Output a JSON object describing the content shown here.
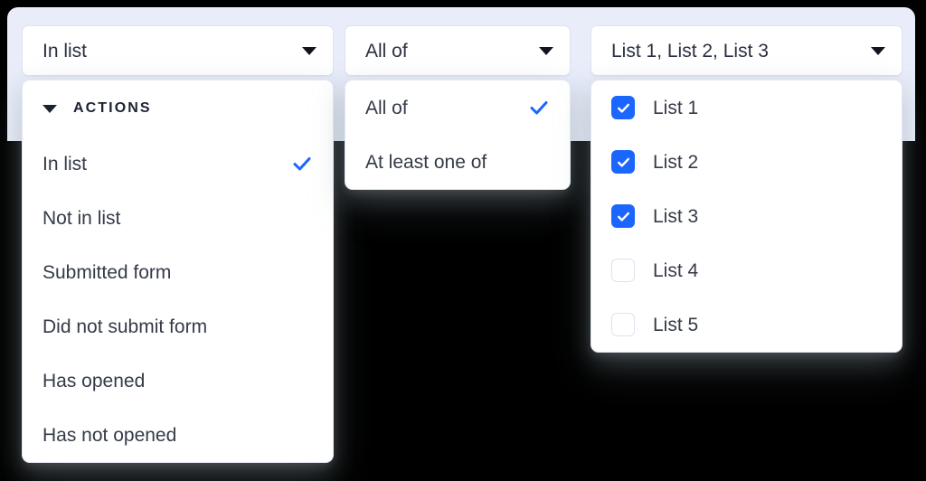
{
  "theme": {
    "band_background": "#e9edfa",
    "page_background": "#000000",
    "accent": "#1a66ff",
    "text": "#343a47",
    "panel_background": "#ffffff",
    "border": "#e3e7f2"
  },
  "action_select": {
    "name": "action",
    "value": "In list",
    "caret_icon": "chevron-down-icon",
    "group": {
      "label": "ACTIONS",
      "caret_icon": "triangle-down-icon",
      "expanded": true
    },
    "options": [
      {
        "label": "In list",
        "selected": true
      },
      {
        "label": "Not in list",
        "selected": false
      },
      {
        "label": "Submitted form",
        "selected": false
      },
      {
        "label": "Did not submit form",
        "selected": false
      },
      {
        "label": "Has opened",
        "selected": false
      },
      {
        "label": "Has not opened",
        "selected": false
      }
    ]
  },
  "match_select": {
    "name": "match-type",
    "value": "All of",
    "caret_icon": "chevron-down-icon",
    "options": [
      {
        "label": "All of",
        "selected": true
      },
      {
        "label": "At least one of",
        "selected": false
      }
    ]
  },
  "lists_select": {
    "name": "lists",
    "value": "List 1, List 2, List 3",
    "caret_icon": "chevron-down-icon",
    "options": [
      {
        "label": "List 1",
        "checked": true
      },
      {
        "label": "List 2",
        "checked": true
      },
      {
        "label": "List 3",
        "checked": true
      },
      {
        "label": "List 4",
        "checked": false
      },
      {
        "label": "List 5",
        "checked": false
      }
    ]
  }
}
